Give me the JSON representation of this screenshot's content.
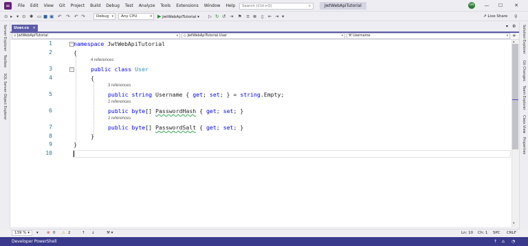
{
  "titlebar": {
    "menu": [
      "File",
      "Edit",
      "View",
      "Git",
      "Project",
      "Build",
      "Debug",
      "Test",
      "Analyze",
      "Tools",
      "Extensions",
      "Window",
      "Help"
    ],
    "search_placeholder": "Search (Ctrl+Q)",
    "solution_name": "JwtWebApiTutorial",
    "avatar_initials": "GN",
    "minimize": "—",
    "maximize": "☐",
    "close": "✕"
  },
  "toolbar": {
    "configuration": "Debug",
    "platform": "Any CPU",
    "run_target": "JwtWebApiTutorial",
    "live_share": "Live Share"
  },
  "tabs": [
    {
      "label": "User.cs",
      "close": "×"
    }
  ],
  "navbar": {
    "project": "JwtWebApiTutorial",
    "type": "JwtWebApiTutorial.User",
    "member": "Username"
  },
  "side_left": [
    "Server Explorer",
    "Toolbox",
    "SQL Server Object Explorer"
  ],
  "side_right": [
    "Solution Explorer",
    "Git Changes",
    "Team Explorer",
    "Class View",
    "Properties"
  ],
  "code": {
    "line_numbers": [
      "1",
      "2",
      "3",
      "4",
      "5",
      "6",
      "7",
      "8",
      "9",
      "10"
    ],
    "lines": {
      "l1_kw": "namespace",
      "l1_name": " JwtWebApiTutorial",
      "l2": "{",
      "ref3": "4 references",
      "l3_kw": "public class",
      "l3_name": " User",
      "l4": "{",
      "ref5": "3 references",
      "l5_kw1": "public",
      "l5_kw2": " string",
      "l5_mid": " Username { ",
      "l5_get": "get",
      "l5_semi1": "; ",
      "l5_set": "set",
      "l5_end": "; } = ",
      "l5_str": "string",
      "l5_tail": ".Empty;",
      "ref6": "2 references",
      "l6_kw": "public",
      "l6_type": " byte",
      "l6_arr": "[] ",
      "l6_name": "PasswordHash",
      "l6_mid": " { ",
      "l6_get": "get",
      "l6_semi": "; ",
      "l6_set": "set",
      "l6_end": "; }",
      "ref7": "2 references",
      "l7_kw": "public",
      "l7_type": " byte",
      "l7_arr": "[] ",
      "l7_name": "PasswordSalt",
      "l7_mid": " { ",
      "l7_get": "get",
      "l7_semi": "; ",
      "l7_set": "set",
      "l7_end": "; }",
      "l8": "}",
      "l9": "}"
    },
    "fold_minus": "−"
  },
  "editor_status": {
    "zoom": "139 %",
    "errors": "0",
    "warnings": "2",
    "line": "Ln: 10",
    "col": "Ch: 1",
    "whitespace": "SPC",
    "line_ending": "CRLF"
  },
  "statusbar": {
    "text": "Developer PowerShell"
  }
}
